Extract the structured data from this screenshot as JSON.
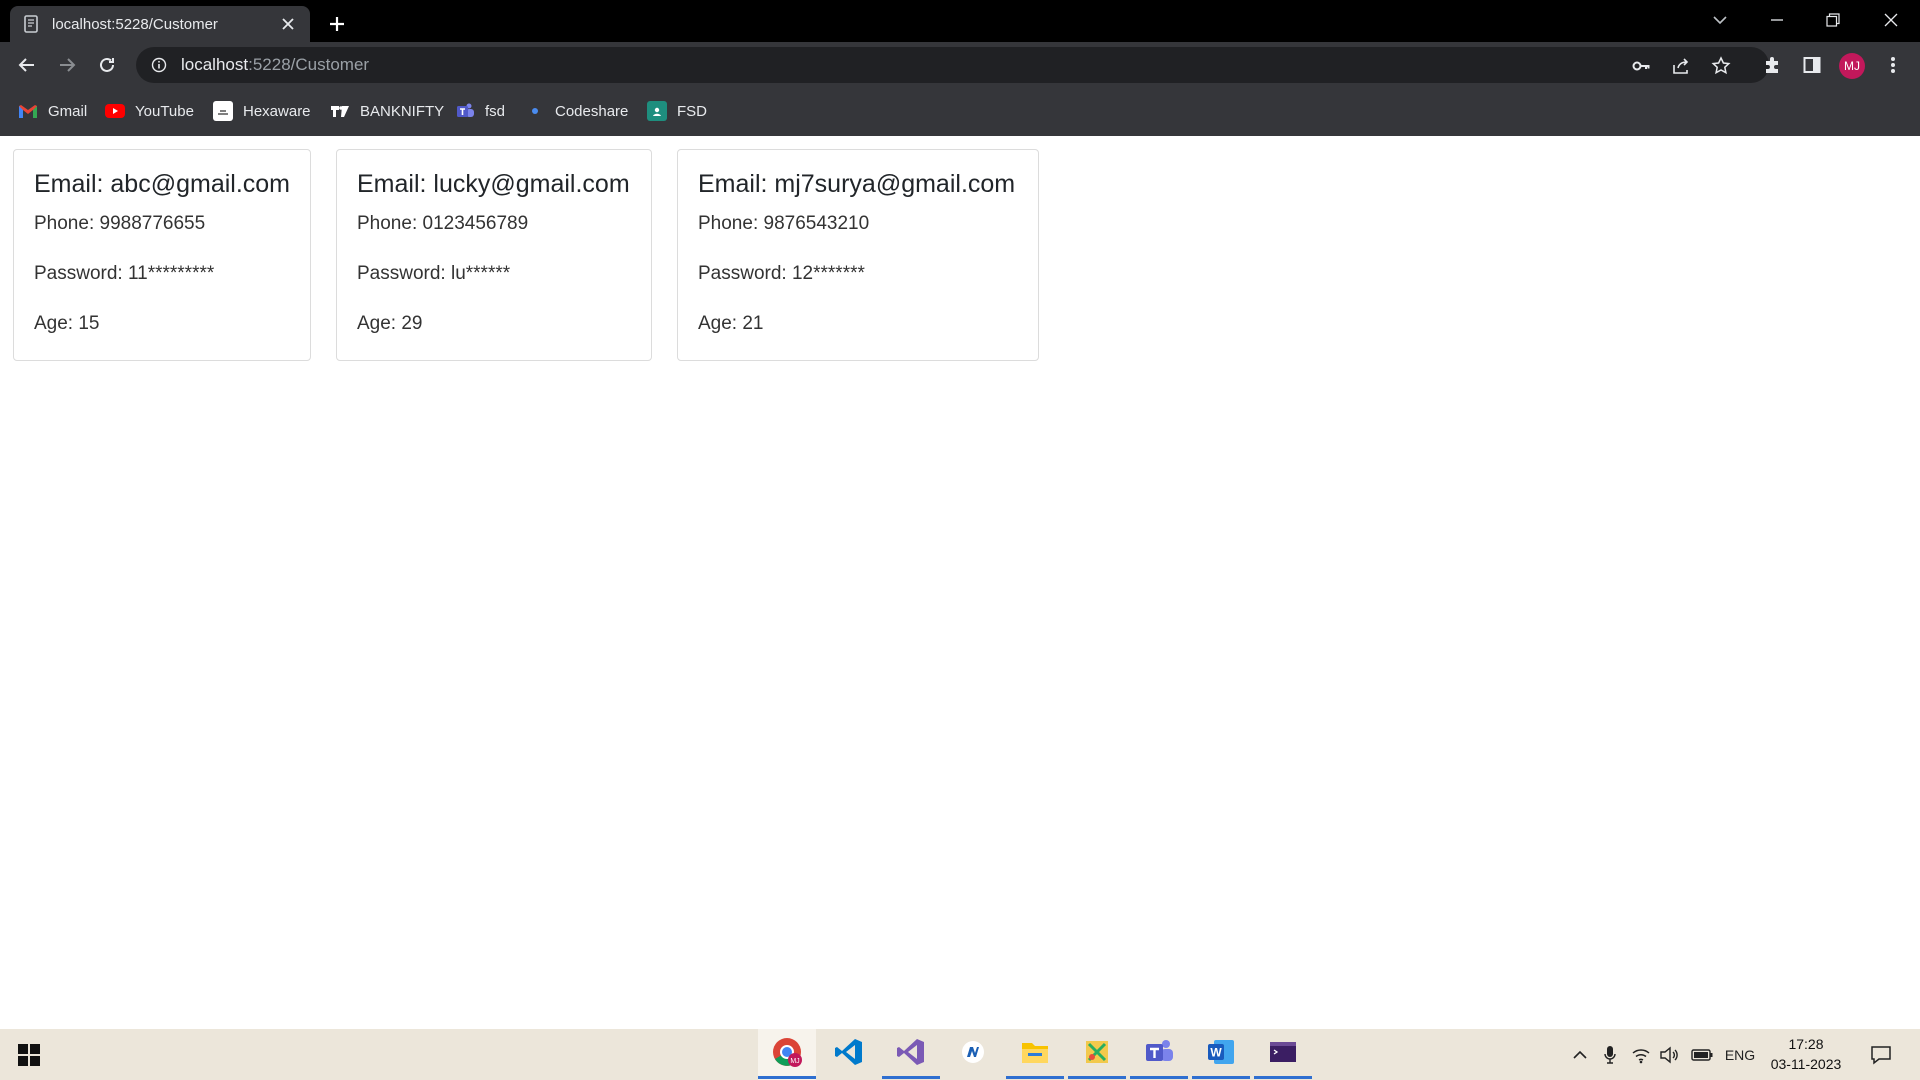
{
  "browser": {
    "tab_title": "localhost:5228/Customer",
    "url_host": "localhost",
    "url_path": ":5228/Customer",
    "profile_initials": "MJ"
  },
  "bookmarks": [
    {
      "label": "Gmail",
      "icon": "gmail-icon"
    },
    {
      "label": "YouTube",
      "icon": "youtube-icon"
    },
    {
      "label": "Hexaware",
      "icon": "hexaware-icon"
    },
    {
      "label": "BANKNIFTY",
      "icon": "tradingview-icon"
    },
    {
      "label": "fsd",
      "icon": "teams-icon"
    },
    {
      "label": "Codeshare",
      "icon": "dot-icon"
    },
    {
      "label": "FSD",
      "icon": "classroom-icon"
    }
  ],
  "customers": [
    {
      "email": "Email: abc@gmail.com",
      "phone": "Phone: 9988776655",
      "password": "Password: 11*********",
      "age": "Age: 15"
    },
    {
      "email": "Email: lucky@gmail.com",
      "phone": "Phone: 0123456789",
      "password": "Password: lu******",
      "age": "Age: 29"
    },
    {
      "email": "Email: mj7surya@gmail.com",
      "phone": "Phone: 9876543210",
      "password": "Password: 12*******",
      "age": "Age: 21"
    }
  ],
  "taskbar": {
    "apps": [
      "chrome-icon",
      "vscode-icon",
      "visual-studio-icon",
      "edge-icon",
      "file-explorer-icon",
      "snip-icon",
      "teams-icon",
      "word-icon",
      "terminal-icon"
    ],
    "language": "ENG",
    "time": "17:28",
    "date": "03-11-2023"
  },
  "colors": {
    "chrome_dark": "#35363a",
    "titlebar": "#000000",
    "omnibox": "#202124",
    "avatar": "#c2185b",
    "taskbar": "#ece6da",
    "taskbar_indicator": "#2f6fd0"
  }
}
